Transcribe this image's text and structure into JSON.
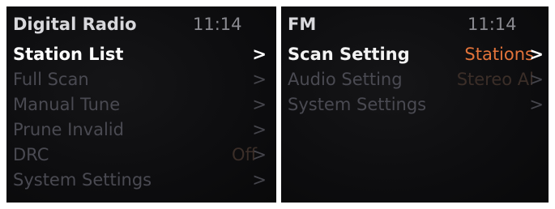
{
  "left_screen": {
    "title": "Digital Radio",
    "time": "11:14",
    "items": [
      {
        "label": "Station List",
        "value": "",
        "chevron": ">"
      },
      {
        "label": "Full Scan",
        "value": "",
        "chevron": ">"
      },
      {
        "label": "Manual Tune",
        "value": "",
        "chevron": ">"
      },
      {
        "label": "Prune Invalid",
        "value": "",
        "chevron": ">"
      },
      {
        "label": "DRC",
        "value": "Off",
        "chevron": ">"
      },
      {
        "label": "System Settings",
        "value": "",
        "chevron": ">"
      }
    ]
  },
  "right_screen": {
    "title": "FM",
    "time": "11:14",
    "items": [
      {
        "label": "Scan Setting",
        "value": "Stations",
        "chevron": ">"
      },
      {
        "label": "Audio Setting",
        "value": "Stereo Al",
        "chevron": ">"
      },
      {
        "label": "System Settings",
        "value": "",
        "chevron": ">"
      }
    ]
  },
  "colors": {
    "selected_text": "#ffffff",
    "dim_text": "#4a4a52",
    "accent_value": "#e2733a",
    "background": "#0d0d0f"
  }
}
